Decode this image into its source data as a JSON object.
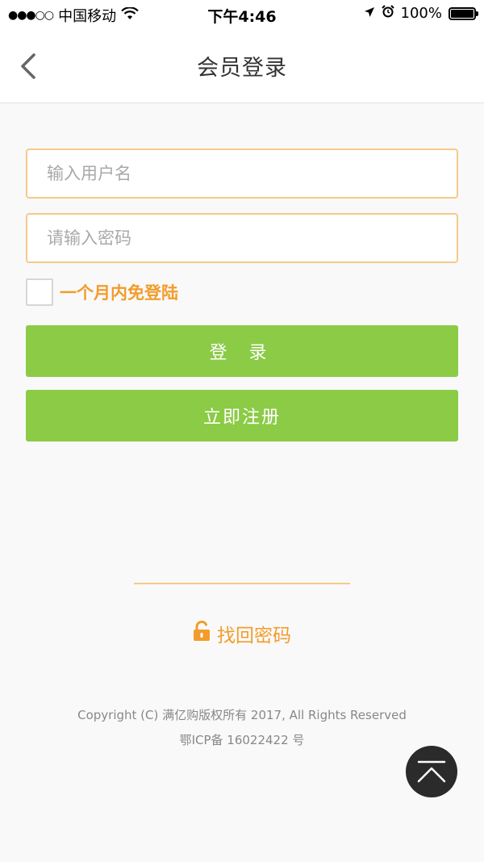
{
  "status_bar": {
    "carrier": "中国移动",
    "time": "下午4:46",
    "battery": "100%"
  },
  "header": {
    "title": "会员登录"
  },
  "form": {
    "username_placeholder": "输入用户名",
    "password_placeholder": "请输入密码",
    "remember_label": "一个月内免登陆",
    "login_label": "登 录",
    "register_label": "立即注册"
  },
  "find_password": {
    "label": "找回密码"
  },
  "footer": {
    "copyright": "Copyright (C) 满亿购版权所有 2017, All Rights Reserved",
    "icp": "鄂ICP备 16022422 号"
  },
  "colors": {
    "accent_green": "#8bcb46",
    "accent_orange": "#f39c2b",
    "input_border": "#f7c98a"
  }
}
